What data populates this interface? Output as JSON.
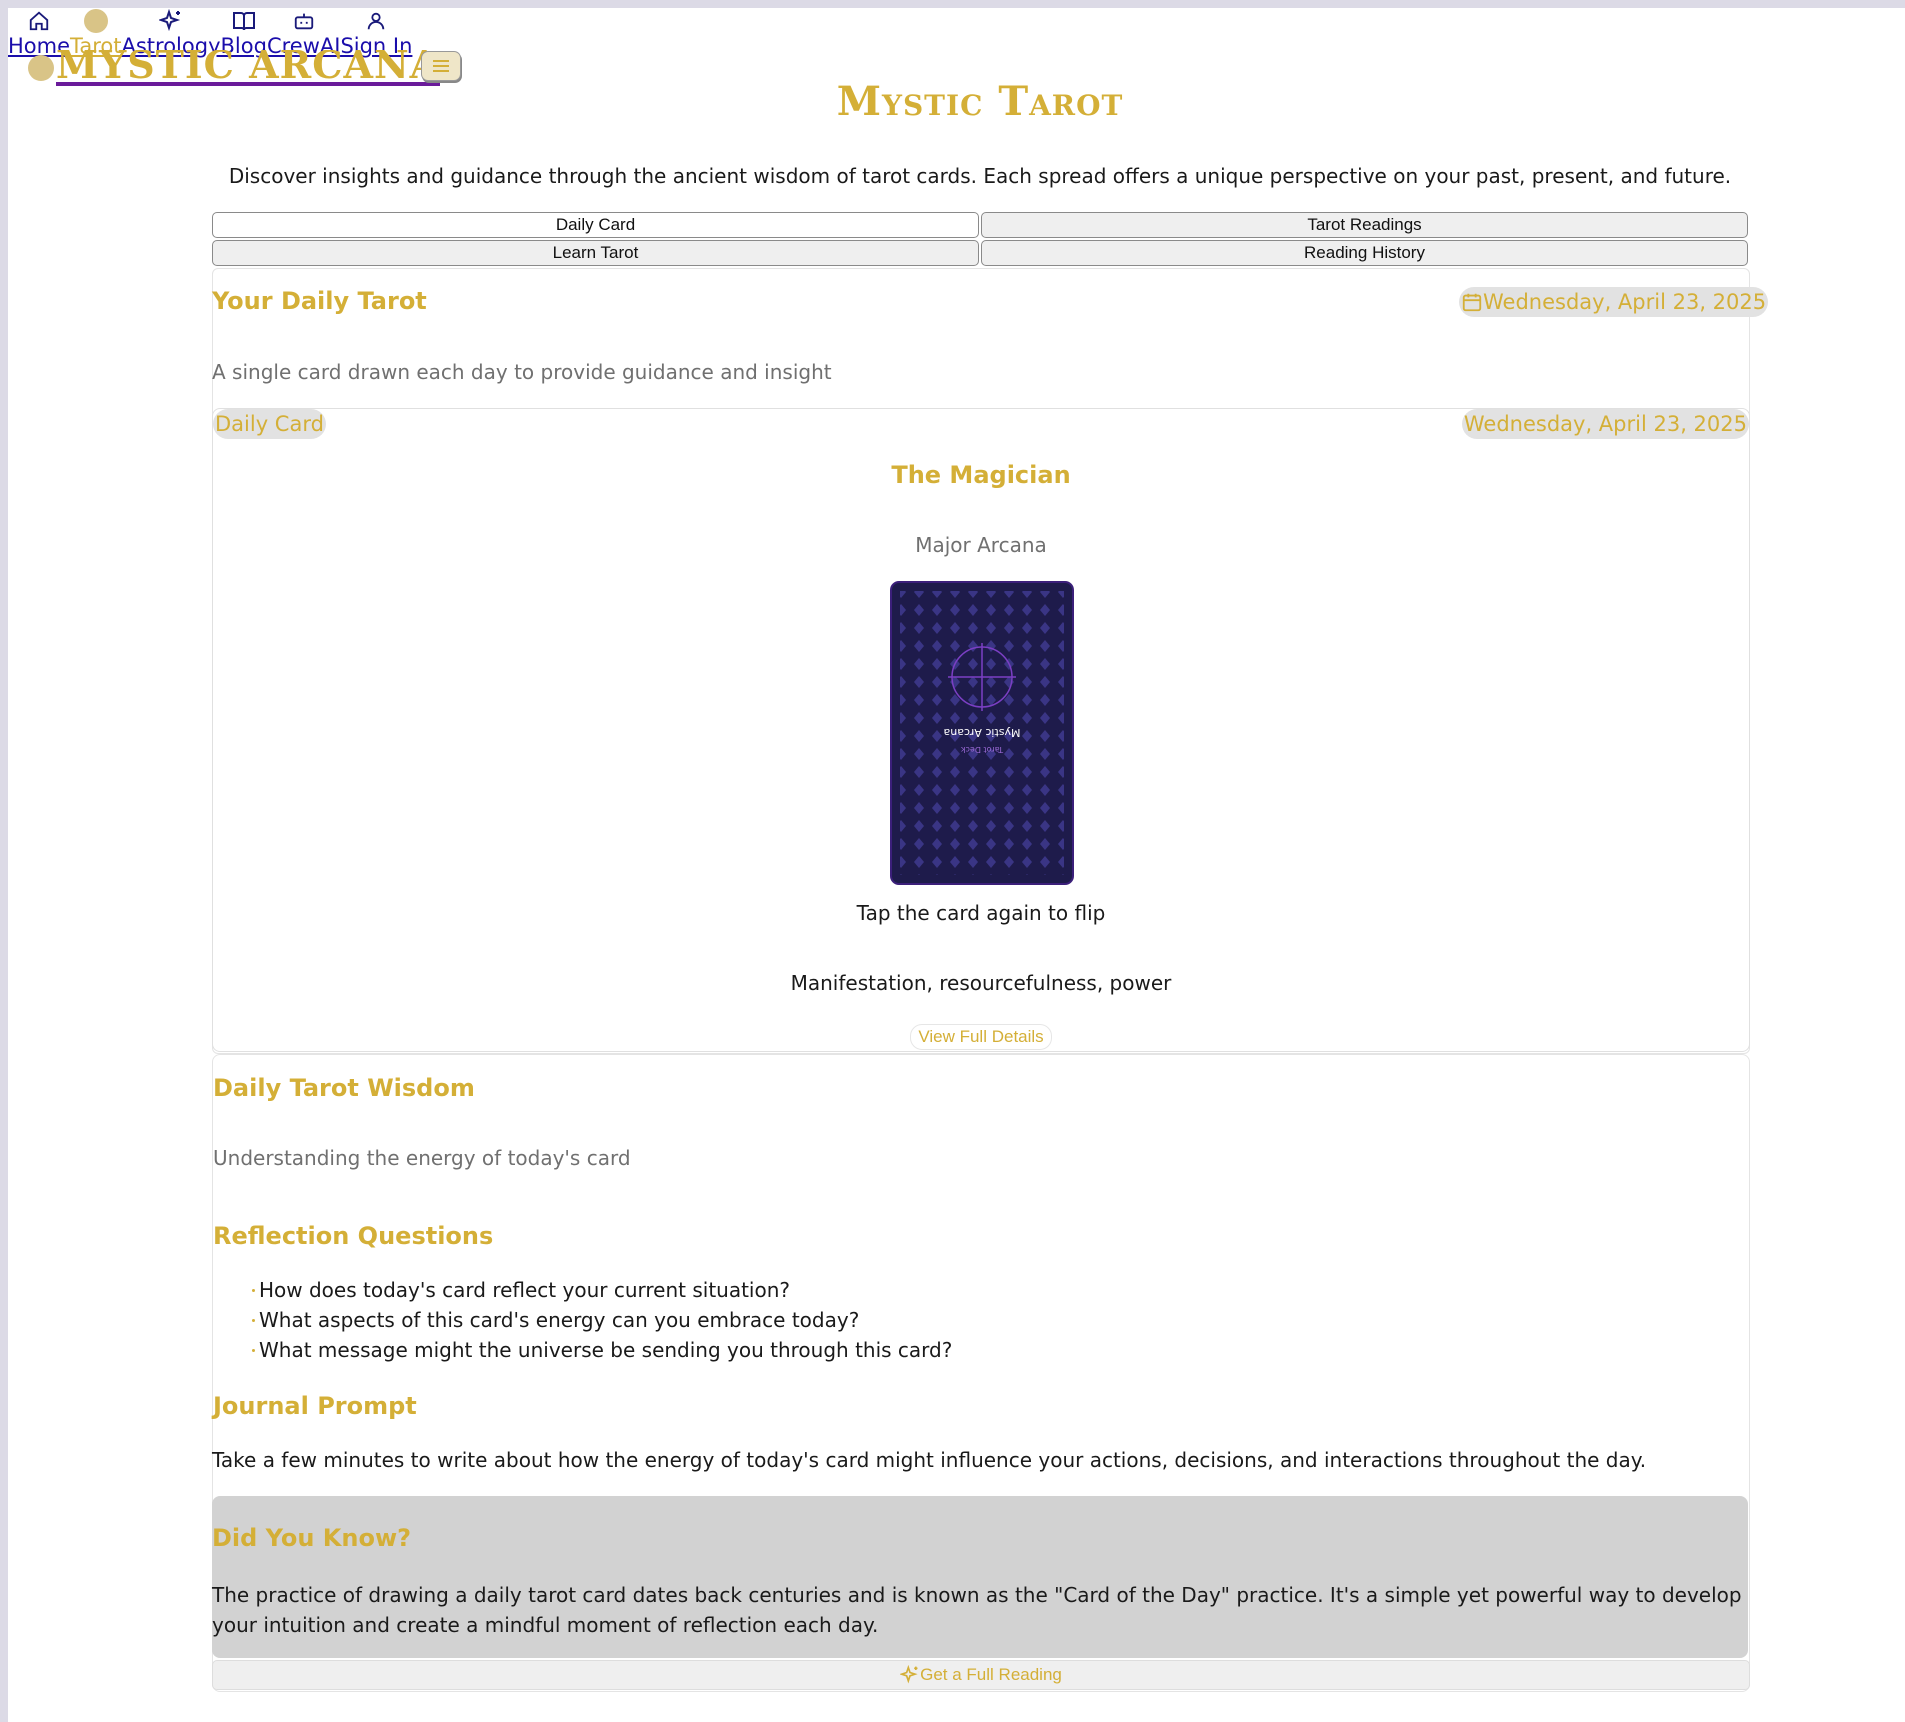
{
  "nav": {
    "items": [
      {
        "label": "Home",
        "icon": "home-icon"
      },
      {
        "label": "Tarot",
        "icon": "tarot-icon"
      },
      {
        "label": "Astrology",
        "icon": "sparkles-icon"
      },
      {
        "label": "Blog",
        "icon": "book-icon"
      },
      {
        "label": "CrewAI",
        "icon": "bot-icon"
      },
      {
        "label": "Sign In",
        "icon": "user-icon"
      }
    ],
    "active": "Tarot"
  },
  "brand": {
    "name": "MYSTIC ARCANA"
  },
  "page": {
    "title": "Mystic Tarot",
    "intro": "Discover insights and guidance through the ancient wisdom of tarot cards. Each spread offers a unique perspective on your past, present, and future."
  },
  "tabs": [
    "Daily Card",
    "Tarot Readings",
    "Learn Tarot",
    "Reading History"
  ],
  "daily": {
    "title": "Your Daily Tarot",
    "date": "Wednesday, April 23, 2025",
    "subtitle": "A single card drawn each day to provide guidance and insight",
    "badge": "Daily Card",
    "badge_date": "Wednesday, April 23, 2025",
    "card_name": "The Magician",
    "card_arcana": "Major Arcana",
    "card_back_text": "Mystic Arcana",
    "card_back_sub": "Tarot Deck",
    "tap_hint": "Tap the card again to flip",
    "keywords": "Manifestation, resourcefulness, power",
    "details_button": "View Full Details"
  },
  "wisdom": {
    "title": "Daily Tarot Wisdom",
    "subtitle": "Understanding the energy of today's card",
    "questions_title": "Reflection Questions",
    "questions": [
      "How does today's card reflect your current situation?",
      "What aspects of this card's energy can you embrace today?",
      "What message might the universe be sending you through this card?"
    ],
    "journal_title": "Journal Prompt",
    "journal_text": "Take a few minutes to write about how the energy of today's card might influence your actions, decisions, and interactions throughout the day.",
    "did_title": "Did You Know?",
    "did_text": "The practice of drawing a daily tarot card dates back centuries and is known as the \"Card of the Day\" practice. It's a simple yet powerful way to develop your intuition and create a mindful moment of reflection each day.",
    "cta": "Get a Full Reading"
  },
  "colors": {
    "accent": "#d4af37",
    "card_back": "#1e1b4b",
    "link": "#1a0dab"
  }
}
